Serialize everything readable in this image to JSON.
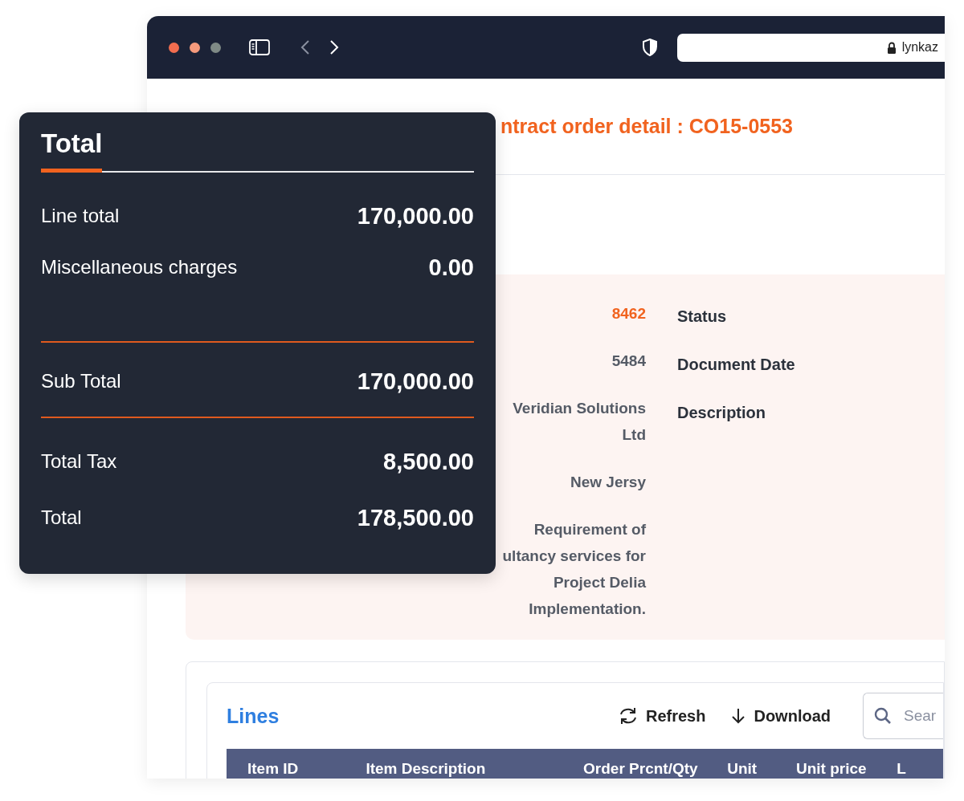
{
  "browser": {
    "address": "lynkaz"
  },
  "page": {
    "title": "ntract order detail : CO15-0553"
  },
  "details": {
    "values": [
      {
        "text": "8462",
        "kind": "link"
      },
      {
        "text": "5484",
        "kind": "plain"
      },
      {
        "text": "Veridian Solutions Ltd",
        "kind": "plain"
      },
      {
        "text": "New Jersy",
        "kind": "plain"
      },
      {
        "text": "Requirement of\nultancy services for\nProject Delia\nImplementation.",
        "kind": "plain"
      }
    ],
    "labels": [
      "Status",
      "Document Date",
      "Description"
    ]
  },
  "lines": {
    "title": "Lines",
    "actions": [
      {
        "label": "Refresh",
        "kind": "refresh"
      },
      {
        "label": "Download",
        "kind": "download"
      }
    ],
    "search": {
      "placeholder": "Sear"
    },
    "table": {
      "columns": [
        "Item ID",
        "Item Description",
        "Order Prcnt/Qty",
        "Unit",
        "Unit price",
        "L"
      ]
    }
  },
  "total_card": {
    "title": "Total",
    "rows": [
      {
        "label": "Line total",
        "value": "170,000.00",
        "divider_after": false
      },
      {
        "label": "Miscellaneous charges",
        "value": "0.00",
        "divider_after": true
      },
      {
        "label": "Sub Total",
        "value": "170,000.00",
        "divider_after": true
      },
      {
        "label": "Total Tax",
        "value": "8,500.00",
        "divider_after": false
      },
      {
        "label": "Total",
        "value": "178,500.00",
        "divider_after": false
      }
    ]
  }
}
